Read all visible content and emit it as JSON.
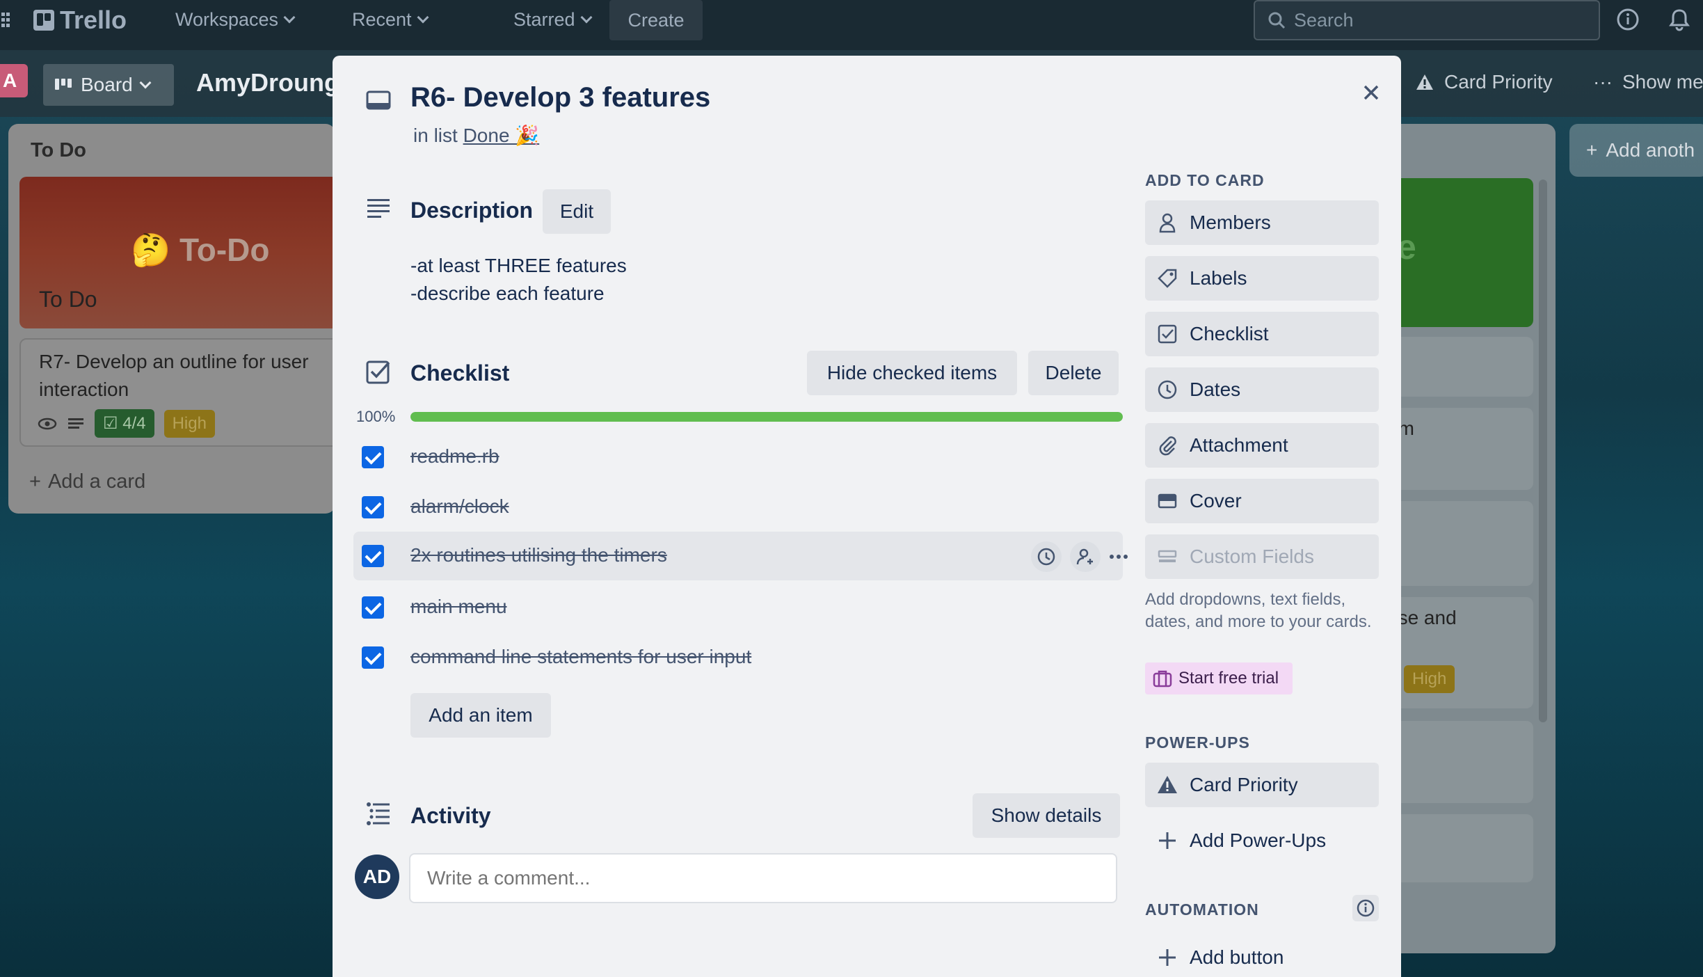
{
  "topbar": {
    "logo": "Trello",
    "nav": [
      "Workspaces",
      "Recent",
      "Starred"
    ],
    "create": "Create",
    "search_placeholder": "Search"
  },
  "board": {
    "workspace_initial": "A",
    "view_label": "Board",
    "title": "AmyDroung",
    "powerup_label": "Card Priority",
    "show_menu": "Show me",
    "add_another": "Add anoth"
  },
  "bg_list_left": {
    "header": "To Do",
    "cover_text": "🤔 To-Do",
    "cover_subtitle": "To Do",
    "card_title": "R7- Develop an outline for user interaction",
    "checklist_badge": "4/4",
    "priority_badge": "High",
    "add_card": "Add a card"
  },
  "bg_list_right": {
    "cover_char": "e",
    "snippets": [
      "am",
      "ose and",
      "High",
      "s"
    ]
  },
  "card": {
    "title": "R6- Develop 3 features",
    "in_list_prefix": "in list",
    "list_name": "Done 🎉",
    "description": {
      "title": "Description",
      "edit": "Edit",
      "lines": [
        "-at least THREE features",
        "-describe each feature"
      ]
    },
    "checklist": {
      "title": "Checklist",
      "hide_checked": "Hide checked items",
      "delete": "Delete",
      "percent_label": "100%",
      "progress": 1.0,
      "items": [
        {
          "text": "readme.rb",
          "checked": true
        },
        {
          "text": "alarm/clock",
          "checked": true
        },
        {
          "text": "2x routines utilising the timers",
          "checked": true
        },
        {
          "text": "main menu",
          "checked": true
        },
        {
          "text": "command line statements for user input",
          "checked": true
        }
      ],
      "add_item": "Add an item"
    },
    "activity": {
      "title": "Activity",
      "show_details": "Show details",
      "avatar_initials": "AD",
      "comment_placeholder": "Write a comment..."
    }
  },
  "sidebar": {
    "add_to_card_heading": "Add to card",
    "add_to_card": [
      "Members",
      "Labels",
      "Checklist",
      "Dates",
      "Attachment",
      "Cover",
      "Custom Fields"
    ],
    "custom_fields_help": "Add dropdowns, text fields, dates, and more to your cards.",
    "start_trial": "Start free trial",
    "powerups_heading": "Power-Ups",
    "powerups": [
      "Card Priority",
      "Add Power-Ups"
    ],
    "automation_heading": "Automation",
    "automation": [
      "Add button"
    ]
  },
  "colors": {
    "progress_fill": "#61bd4f",
    "checkbox": "#0c66e4",
    "trial_bg": "#f3d9f5"
  }
}
